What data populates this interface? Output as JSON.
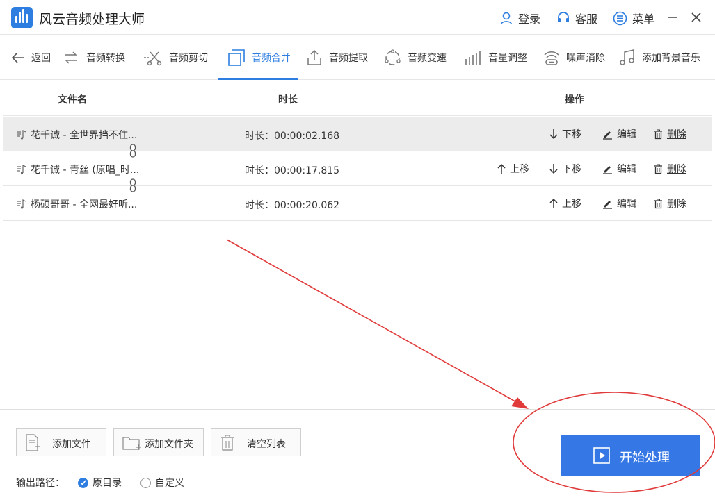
{
  "app": {
    "title": "风云音频处理大师"
  },
  "header": {
    "login_label": "登录",
    "service_label": "客服",
    "menu_label": "菜单"
  },
  "toolnav": {
    "back_label": "返回",
    "items": [
      {
        "label": "音频转换"
      },
      {
        "label": "音频剪切"
      },
      {
        "label": "音频合并"
      },
      {
        "label": "音频提取"
      },
      {
        "label": "音频变速"
      },
      {
        "label": "音量调整"
      },
      {
        "label": "噪声消除"
      },
      {
        "label": "添加背景音乐"
      }
    ],
    "active": "音频合并"
  },
  "table": {
    "columns": {
      "name": "文件名",
      "duration": "时长",
      "ops": "操作"
    },
    "rows": [
      {
        "name": "花千诚 - 全世界挡不住...",
        "duration": "时长：00:00:02.168",
        "down": "下移",
        "edit": "编辑",
        "delete": "删除"
      },
      {
        "name": "花千诚 - 青丝 (原唱_时...",
        "duration": "时长：00:00:17.815",
        "up": "上移",
        "down": "下移",
        "edit": "编辑",
        "delete": "删除"
      },
      {
        "name": "杨硕哥哥 - 全网最好听...",
        "duration": "时长：00:00:20.062",
        "up": "上移",
        "edit": "编辑",
        "delete": "删除"
      }
    ]
  },
  "bottom": {
    "add_file": "添加文件",
    "add_folder": "添加文件夹",
    "clear_list": "清空列表",
    "output_label": "输出路径：",
    "opt_original": "原目录",
    "opt_custom": "自定义",
    "start_label": "开始处理"
  },
  "colors": {
    "accent": "#2d7ee0",
    "annotation": "#e03a3a"
  }
}
